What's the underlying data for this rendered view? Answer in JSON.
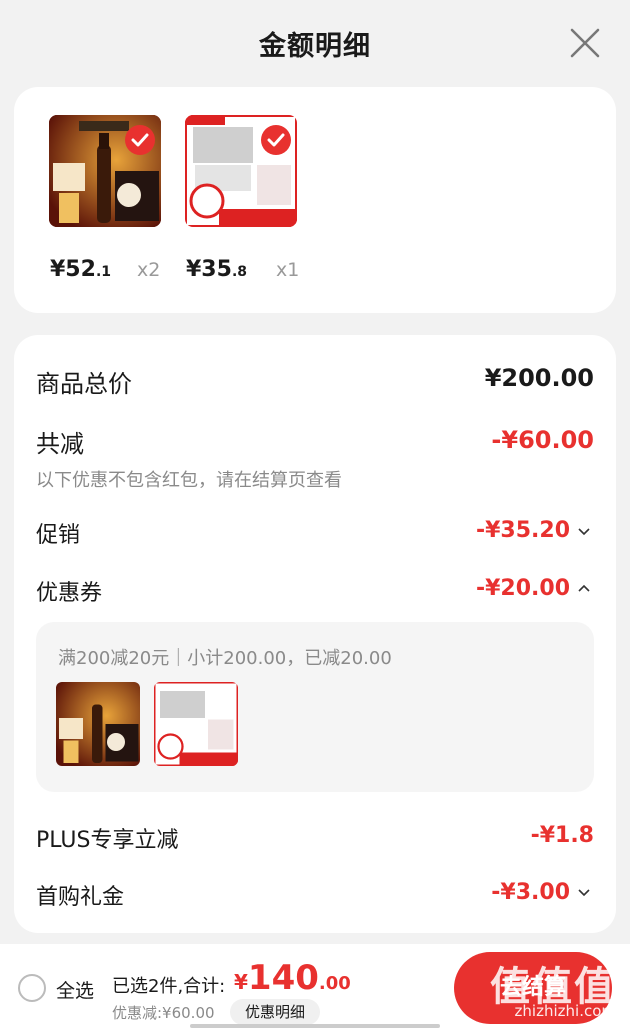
{
  "header": {
    "title": "金额明细"
  },
  "products": [
    {
      "price_int": "¥52",
      "price_dec": ".1",
      "qty": "x2"
    },
    {
      "price_int": "¥35",
      "price_dec": ".8",
      "qty": "x1"
    }
  ],
  "summary": {
    "total_label": "商品总价",
    "total_value": "¥200.00",
    "reduce_label": "共减",
    "reduce_value": "-¥60.00",
    "note": "以下优惠不包含红包，请在结算页查看",
    "promo_label": "促销",
    "promo_value": "-¥35.20",
    "coupon_label": "优惠券",
    "coupon_value": "-¥20.00",
    "coupon_desc": "满200减20元｜小计200.00，已减20.00",
    "plus_label": "PLUS专享立减",
    "plus_value": "-¥1.8",
    "gift_label": "首购礼金",
    "gift_value": "-¥3.00"
  },
  "bottom": {
    "select_all": "全选",
    "selected": "已选2件,合计:",
    "total_sym": "¥",
    "total_int": "140",
    "total_dec": ".00",
    "discount": "优惠减:¥60.00",
    "detail_button": "优惠明细",
    "checkout": "去结算",
    "watermark": "值值值",
    "watermark_url": "zhizhizhi.com"
  },
  "colors": {
    "accent": "#e8312f",
    "background": "#f2f2f2"
  },
  "icons": [
    "close-icon",
    "check-icon",
    "chevron-down-icon",
    "chevron-up-icon",
    "radio-icon"
  ]
}
